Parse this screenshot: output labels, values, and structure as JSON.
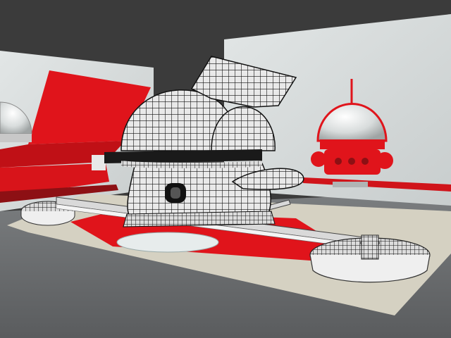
{
  "scene": {
    "colors": {
      "sky": "#3b3b3b",
      "floor": "#6d7072",
      "floor_light": "#8a8d8f",
      "panel": "#d7dcdc",
      "panel_shadow": "#b9bfbf",
      "red": "#e0141b",
      "dark_red": "#8d1014",
      "mat": "#d6d2c3",
      "wire": "#101010",
      "shell": "#f0f0f0",
      "glass": "#e8eeee",
      "track_side": "#dcdcdc"
    },
    "objects": [
      {
        "name": "back-panel-left",
        "desc_icon": "panel"
      },
      {
        "name": "back-panel-right",
        "desc_icon": "panel"
      },
      {
        "name": "red-fin-structure",
        "desc_icon": "fin"
      },
      {
        "name": "domed-robot-on-panel",
        "desc_icon": "robot"
      },
      {
        "name": "mesh-building-main",
        "desc_icon": "wireframe-dome"
      },
      {
        "name": "track-ring-left",
        "desc_icon": "ring"
      },
      {
        "name": "track-ring-right",
        "desc_icon": "ring"
      },
      {
        "name": "track-rail",
        "desc_icon": "rail"
      },
      {
        "name": "ground-mat",
        "desc_icon": "mat"
      }
    ]
  }
}
